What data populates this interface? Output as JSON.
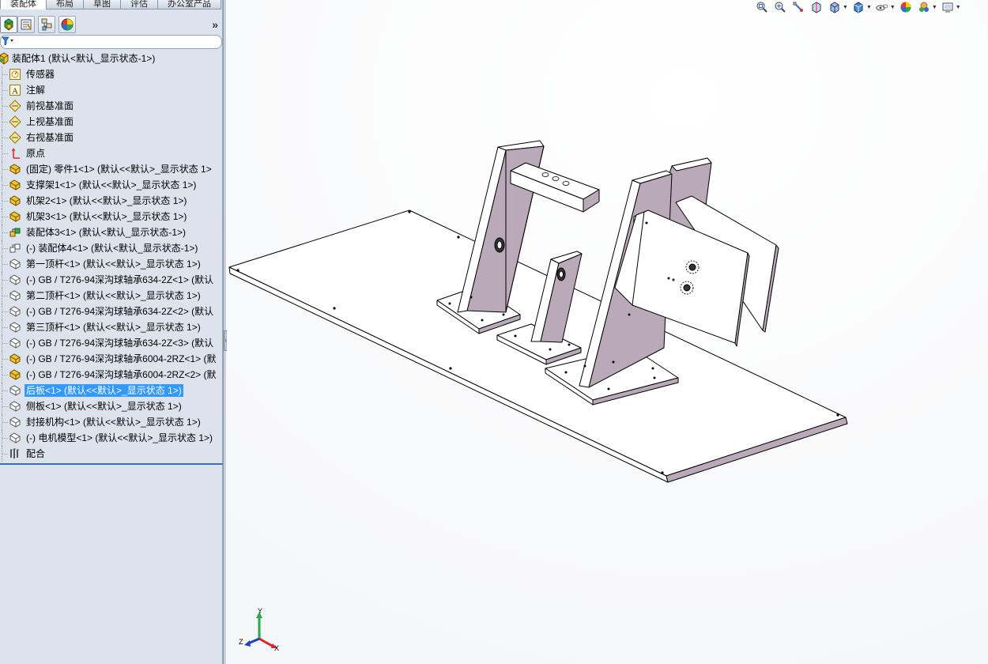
{
  "command_tabs": [
    {
      "label": "装配体",
      "active": true
    },
    {
      "label": "布局",
      "active": false
    },
    {
      "label": "草图",
      "active": false
    },
    {
      "label": "评估",
      "active": false
    },
    {
      "label": "办公室产品",
      "active": false
    }
  ],
  "pane_tabs": [
    {
      "icon": "feature-manager-icon",
      "active": true
    },
    {
      "icon": "property-manager-icon",
      "active": false
    },
    {
      "icon": "configuration-manager-icon",
      "active": false
    },
    {
      "icon": "display-manager-icon",
      "active": false
    }
  ],
  "pane_toolbar": {
    "expand_glyph": "»"
  },
  "filter": {
    "icon": "filter-icon",
    "glyph": "▼"
  },
  "tree": {
    "items": [
      {
        "label": "装配体1  (默认<默认_显示状态-1>)",
        "icon": "assembly-icon"
      },
      {
        "label": "传感器",
        "icon": "sensor-icon"
      },
      {
        "label": "注解",
        "icon": "annotation-icon"
      },
      {
        "label": "前视基准面",
        "icon": "plane-icon"
      },
      {
        "label": "上视基准面",
        "icon": "plane-icon"
      },
      {
        "label": "右视基准面",
        "icon": "plane-icon"
      },
      {
        "label": "原点",
        "icon": "origin-icon"
      },
      {
        "label": "(固定) 零件1<1> (默认<<默认>_显示状态 1>",
        "icon": "part-icon"
      },
      {
        "label": "支撑架1<1> (默认<<默认>_显示状态 1>)",
        "icon": "part-icon"
      },
      {
        "label": "机架2<1> (默认<<默认>_显示状态 1>)",
        "icon": "part-icon"
      },
      {
        "label": "机架3<1> (默认<<默认>_显示状态 1>)",
        "icon": "part-icon"
      },
      {
        "label": "装配体3<1> (默认<默认_显示状态-1>)",
        "icon": "subassembly-icon"
      },
      {
        "label": "(-) 装配体4<1> (默认<默认_显示状态-1>)",
        "icon": "subassembly-outline-icon"
      },
      {
        "label": "第一顶杆<1> (默认<<默认>_显示状态 1>)",
        "icon": "part-outline-icon"
      },
      {
        "label": "(-) GB / T276-94深沟球轴承634-2Z<1> (默认",
        "icon": "part-outline-icon"
      },
      {
        "label": "第二顶杆<1> (默认<<默认>_显示状态 1>)",
        "icon": "part-outline-icon"
      },
      {
        "label": "(-) GB / T276-94深沟球轴承634-2Z<2> (默认",
        "icon": "part-outline-icon"
      },
      {
        "label": "第三顶杆<1> (默认<<默认>_显示状态 1>)",
        "icon": "part-outline-icon"
      },
      {
        "label": "(-) GB / T276-94深沟球轴承634-2Z<3> (默认",
        "icon": "part-outline-icon"
      },
      {
        "label": "(-) GB / T276-94深沟球轴承6004-2RZ<1> (默",
        "icon": "part-icon"
      },
      {
        "label": "(-) GB / T276-94深沟球轴承6004-2RZ<2> (默",
        "icon": "part-icon"
      },
      {
        "label": "后板<1> (默认<<默认>_显示状态 1>)",
        "icon": "part-outline-icon",
        "selected": true
      },
      {
        "label": "侧板<1> (默认<<默认>_显示状态 1>)",
        "icon": "part-outline-icon"
      },
      {
        "label": "封接机构<1> (默认<<默认>_显示状态 1>)",
        "icon": "part-outline-icon"
      },
      {
        "label": "(-) 电机模型<1> (默认<<默认>_显示状态 1>)",
        "icon": "part-outline-icon"
      },
      {
        "label": "配合",
        "icon": "mates-icon"
      }
    ]
  },
  "heads_up_toolbar": [
    {
      "icon": "zoom-to-fit-icon"
    },
    {
      "icon": "zoom-to-area-icon"
    },
    {
      "icon": "previous-view-icon"
    },
    {
      "icon": "section-view-icon"
    },
    {
      "icon": "view-orientation-icon",
      "dropdown": true
    },
    {
      "icon": "display-style-icon",
      "dropdown": true
    },
    {
      "icon": "hide-show-items-icon",
      "dropdown": true
    },
    {
      "icon": "edit-appearance-icon"
    },
    {
      "icon": "apply-scene-icon",
      "dropdown": true
    },
    {
      "icon": "view-settings-icon",
      "dropdown": true
    }
  ],
  "triad": {
    "x_label": "X",
    "y_label": "Y",
    "z_label": "Z"
  },
  "colors": {
    "pane_bg": "#dde3ec",
    "selection": "#3399ff",
    "part_face": "#b8a9b8",
    "part_face_light": "#ffffff",
    "edge": "#000000"
  }
}
